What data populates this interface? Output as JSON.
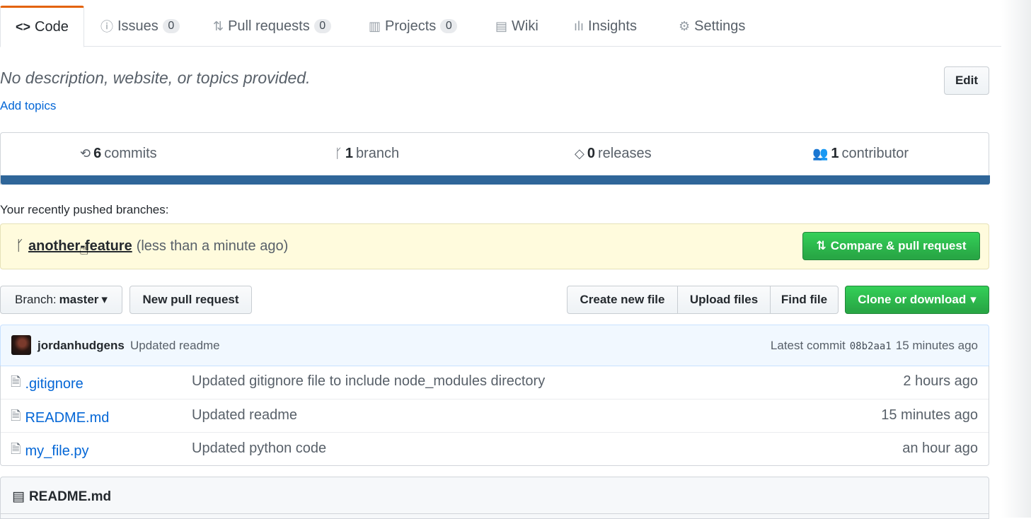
{
  "tabs": [
    {
      "icon": "code-icon",
      "label": "Code"
    },
    {
      "icon": "issue-icon",
      "label": "Issues",
      "count": "0"
    },
    {
      "icon": "pull-request-icon",
      "label": "Pull requests",
      "count": "0"
    },
    {
      "icon": "project-icon",
      "label": "Projects",
      "count": "0"
    },
    {
      "icon": "book-icon",
      "label": "Wiki"
    },
    {
      "icon": "graph-icon",
      "label": "Insights"
    },
    {
      "icon": "gear-icon",
      "label": "Settings"
    }
  ],
  "repo": {
    "description": "No description, website, or topics provided.",
    "add_topics": "Add topics",
    "edit_label": "Edit"
  },
  "stats": {
    "commits_num": "6",
    "commits_label": "commits",
    "branch_num": "1",
    "branch_label": "branch",
    "releases_num": "0",
    "releases_label": "releases",
    "contributor_num": "1",
    "contributor_label": "contributor",
    "language_color": "#2f6699"
  },
  "recent": {
    "label": "Your recently pushed branches:",
    "branch": "another-feature",
    "time": "(less than a minute ago)",
    "compare_label": "Compare & pull request"
  },
  "file_nav": {
    "branch_prefix": "Branch:",
    "branch_name": "master",
    "new_pr": "New pull request",
    "create_file": "Create new file",
    "upload_files": "Upload files",
    "find_file": "Find file",
    "clone": "Clone or download"
  },
  "commit": {
    "user": "jordanhudgens",
    "message": "Updated readme",
    "latest_label": "Latest commit",
    "sha": "08b2aa1",
    "time": "15 minutes ago"
  },
  "files": [
    {
      "name": ".gitignore",
      "message": "Updated gitignore file to include node_modules directory",
      "age": "2 hours ago"
    },
    {
      "name": "README.md",
      "message": "Updated readme",
      "age": "15 minutes ago"
    },
    {
      "name": "my_file.py",
      "message": "Updated python code",
      "age": "an hour ago"
    }
  ],
  "readme": {
    "title": "README.md"
  }
}
